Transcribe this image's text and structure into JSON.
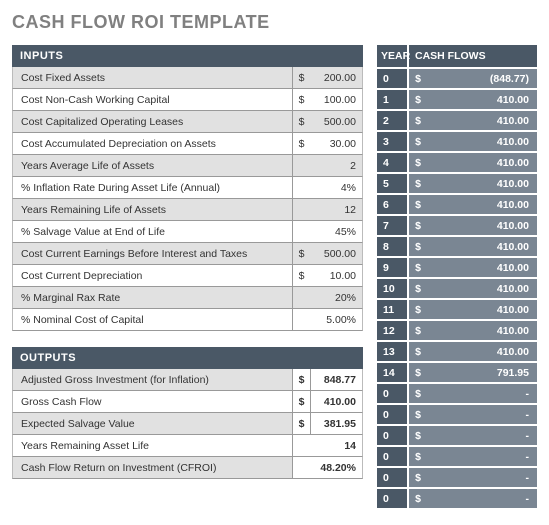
{
  "title": "CASH FLOW ROI TEMPLATE",
  "inputs": {
    "header": "INPUTS",
    "rows": [
      {
        "label": "Cost Fixed Assets",
        "dollar": "$",
        "value": "200.00"
      },
      {
        "label": "Cost Non-Cash Working Capital",
        "dollar": "$",
        "value": "100.00"
      },
      {
        "label": "Cost Capitalized Operating Leases",
        "dollar": "$",
        "value": "500.00"
      },
      {
        "label": "Cost Accumulated Depreciation on Assets",
        "dollar": "$",
        "value": "30.00"
      },
      {
        "label": "Years Average Life of Assets",
        "dollar": "",
        "value": "2"
      },
      {
        "label": "% Inflation Rate During Asset Life (Annual)",
        "dollar": "",
        "value": "4%"
      },
      {
        "label": "Years Remaining Life of Assets",
        "dollar": "",
        "value": "12"
      },
      {
        "label": "% Salvage Value at End of Life",
        "dollar": "",
        "value": "45%"
      },
      {
        "label": "Cost Current Earnings Before Interest and Taxes",
        "dollar": "$",
        "value": "500.00"
      },
      {
        "label": "Cost Current Depreciation",
        "dollar": "$",
        "value": "10.00"
      },
      {
        "label": "% Marginal Rax Rate",
        "dollar": "",
        "value": "20%"
      },
      {
        "label": "% Nominal Cost of Capital",
        "dollar": "",
        "value": "5.00%"
      }
    ]
  },
  "outputs": {
    "header": "OUTPUTS",
    "rows": [
      {
        "label": "Adjusted Gross Investment (for Inflation)",
        "dollar": "$",
        "value": "848.77"
      },
      {
        "label": "Gross Cash Flow",
        "dollar": "$",
        "value": "410.00"
      },
      {
        "label": "Expected Salvage Value",
        "dollar": "$",
        "value": "381.95"
      },
      {
        "label": "Years Remaining Asset Life",
        "dollar": "",
        "value": "14"
      },
      {
        "label": "Cash Flow Return on Investment (CFROI)",
        "dollar": "",
        "value": "48.20%"
      }
    ]
  },
  "cashflows": {
    "yearHeader": "YEAR",
    "cfHeader": "CASH FLOWS",
    "rows": [
      {
        "year": "0",
        "dollar": "$",
        "amount": "(848.77)"
      },
      {
        "year": "1",
        "dollar": "$",
        "amount": "410.00"
      },
      {
        "year": "2",
        "dollar": "$",
        "amount": "410.00"
      },
      {
        "year": "3",
        "dollar": "$",
        "amount": "410.00"
      },
      {
        "year": "4",
        "dollar": "$",
        "amount": "410.00"
      },
      {
        "year": "5",
        "dollar": "$",
        "amount": "410.00"
      },
      {
        "year": "6",
        "dollar": "$",
        "amount": "410.00"
      },
      {
        "year": "7",
        "dollar": "$",
        "amount": "410.00"
      },
      {
        "year": "8",
        "dollar": "$",
        "amount": "410.00"
      },
      {
        "year": "9",
        "dollar": "$",
        "amount": "410.00"
      },
      {
        "year": "10",
        "dollar": "$",
        "amount": "410.00"
      },
      {
        "year": "11",
        "dollar": "$",
        "amount": "410.00"
      },
      {
        "year": "12",
        "dollar": "$",
        "amount": "410.00"
      },
      {
        "year": "13",
        "dollar": "$",
        "amount": "410.00"
      },
      {
        "year": "14",
        "dollar": "$",
        "amount": "791.95"
      },
      {
        "year": "0",
        "dollar": "$",
        "amount": "-"
      },
      {
        "year": "0",
        "dollar": "$",
        "amount": "-"
      },
      {
        "year": "0",
        "dollar": "$",
        "amount": "-"
      },
      {
        "year": "0",
        "dollar": "$",
        "amount": "-"
      },
      {
        "year": "0",
        "dollar": "$",
        "amount": "-"
      },
      {
        "year": "0",
        "dollar": "$",
        "amount": "-"
      }
    ]
  }
}
